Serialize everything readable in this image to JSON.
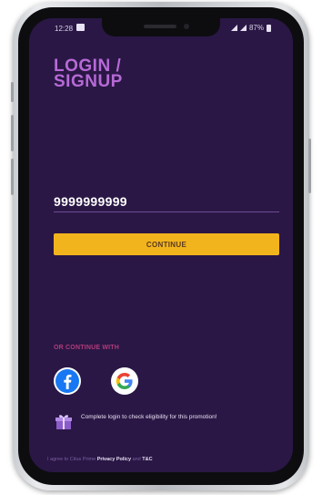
{
  "status_bar": {
    "time": "12:28",
    "battery": "87%"
  },
  "screen": {
    "title": "LOGIN /\nSIGNUP",
    "phone_input": {
      "value": "9999999999",
      "placeholder": ""
    },
    "continue_label": "CONTINUE",
    "or_continue_label": "OR CONTINUE WITH",
    "social": [
      {
        "name": "facebook",
        "icon": "facebook-icon"
      },
      {
        "name": "google",
        "icon": "google-icon"
      }
    ],
    "promo": {
      "icon": "gift-icon",
      "text": "Complete login to check eligibility for this promotion!"
    },
    "footer": {
      "prefix": "I agree to Citus Prime",
      "privacy": "Privacy Policy",
      "and": "and",
      "tnc": "T&C"
    }
  },
  "colors": {
    "background": "#2a1745",
    "title": "#b66ad6",
    "button": "#f2b41c",
    "or_label": "#b23c7a"
  }
}
